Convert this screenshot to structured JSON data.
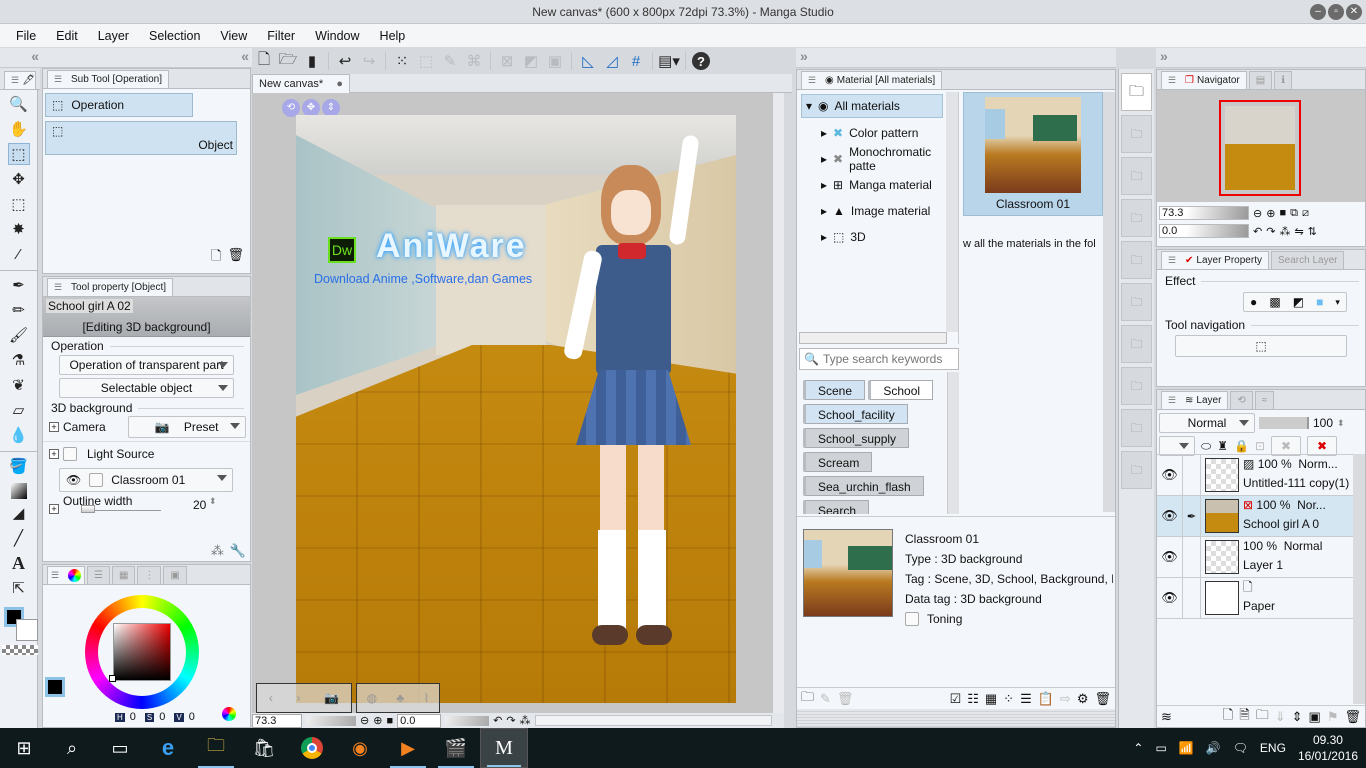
{
  "window": {
    "title": "New canvas* (600 x 800px 72dpi 73.3%)  - Manga Studio",
    "buttons": [
      "minimize",
      "maximize",
      "close"
    ]
  },
  "menu": [
    "File",
    "Edit",
    "Layer",
    "Selection",
    "View",
    "Filter",
    "Window",
    "Help"
  ],
  "toolbar": {
    "icons": [
      "new-file-icon",
      "open-file-icon",
      "save-icon",
      "undo-icon",
      "redo-icon",
      "selection-dots-icon",
      "crop-icon",
      "lasso-icon",
      "transform-icon",
      "clear-selection-icon",
      "fill-selection-icon",
      "frame-icon",
      "ruler-icon",
      "snap-ruler-icon",
      "grid-icon",
      "screen-mode-icon",
      "help-icon"
    ]
  },
  "tools": [
    "zoom",
    "hand",
    "object",
    "move",
    "marquee",
    "auto-select",
    "eyedropper",
    "pen",
    "pencil",
    "brush",
    "airbrush",
    "decoration",
    "eraser",
    "blend",
    "fill",
    "gradient",
    "figure",
    "line",
    "text",
    "correct-line"
  ],
  "sub_tool": {
    "tab": "Sub Tool [Operation]",
    "group": "Operation",
    "item": "Object"
  },
  "tool_property": {
    "tab": "Tool property [Object]",
    "object_name": "School girl A 02",
    "status": "[Editing 3D background]",
    "operation_label": "Operation",
    "operation_mode": "Operation of transparent part",
    "selectable": "Selectable object",
    "bg_label": "3D background",
    "camera_label": "Camera",
    "camera_value": "Preset",
    "light_label": "Light Source",
    "bg_item": "Classroom 01",
    "outline_label": "Outline width",
    "outline_value": "20"
  },
  "color": {
    "h_label": "H",
    "h": "0",
    "s_label": "S",
    "s": "0",
    "v_label": "V",
    "v": "0",
    "main_color": "#000000",
    "sub_color": "#ffffff"
  },
  "canvas": {
    "tab": "New canvas*",
    "watermark_badge": "Dw",
    "watermark_title": "AniWare",
    "watermark_sub": "Download Anime ,Software,dan Games",
    "zoom": "73.3",
    "rotation": "0.0"
  },
  "material": {
    "tab": "Material [All materials]",
    "tree_root": "All materials",
    "tree": [
      "Color pattern",
      "Monochromatic patte",
      "Manga material",
      "Image material",
      "3D"
    ],
    "thumbnail_label": "Classroom 01",
    "hint": "w all the materials in the fol",
    "search_placeholder": "Type search keywords",
    "tags": [
      "Scene",
      "School",
      "School_facility",
      "School_supply",
      "Scream",
      "Sea_urchin_flash",
      "Search"
    ],
    "detail": {
      "name": "Classroom 01",
      "type": "Type : 3D background",
      "tag": "Tag : Scene, 3D, School, Background, Inte",
      "data_tag": "Data tag : 3D background",
      "toning": "Toning"
    }
  },
  "navigator": {
    "tab": "Navigator",
    "zoom": "73.3",
    "rotation": "0.0"
  },
  "layer_property": {
    "tab": "Layer Property",
    "tab2": "Search Layer",
    "effect_label": "Effect",
    "tool_nav_label": "Tool navigation"
  },
  "layers": {
    "tab": "Layer",
    "blend_mode": "Normal",
    "opacity": "100",
    "items": [
      {
        "opacity": "100 %",
        "mode": "Norm...",
        "name": "Untitled-111 copy(1)"
      },
      {
        "opacity": "100 %",
        "mode": "Nor...",
        "name": "School girl A 0",
        "selected": true
      },
      {
        "opacity": "100 %",
        "mode": "Normal",
        "name": "Layer 1"
      },
      {
        "opacity": "",
        "mode": "",
        "name": "Paper"
      }
    ]
  },
  "taskbar": {
    "apps": [
      "start",
      "search",
      "task-view",
      "edge",
      "file-explorer",
      "store",
      "chrome",
      "firefox",
      "media-player",
      "movie-maker",
      "manga-studio"
    ],
    "lang": "ENG",
    "time": "09.30",
    "date": "16/01/2016"
  }
}
